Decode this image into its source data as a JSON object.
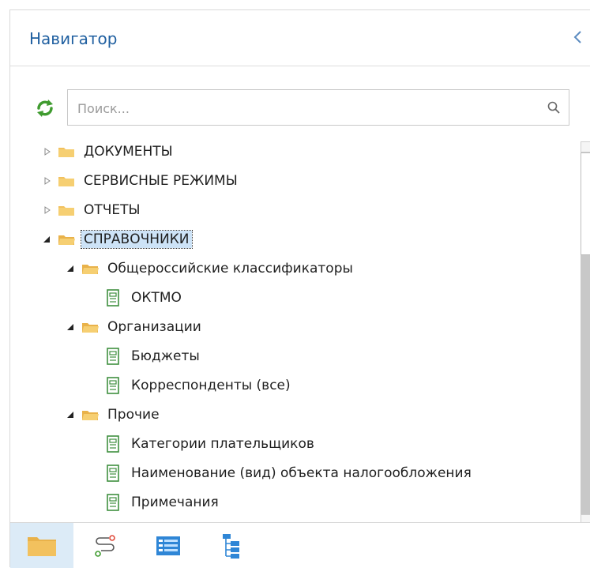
{
  "header": {
    "title": "Навигатор"
  },
  "search": {
    "placeholder": "Поиск..."
  },
  "tree": [
    {
      "label": "ДОКУМЕНТЫ",
      "type": "folder",
      "state": "collapsed"
    },
    {
      "label": "СЕРВИСНЫЕ РЕЖИМЫ",
      "type": "folder",
      "state": "collapsed"
    },
    {
      "label": "ОТЧЕТЫ",
      "type": "folder",
      "state": "collapsed"
    },
    {
      "label": "СПРАВОЧНИКИ",
      "type": "folder",
      "state": "expanded",
      "selected": true
    },
    {
      "label": "Общероссийские классификаторы",
      "type": "folder",
      "state": "expanded"
    },
    {
      "label": "ОКТМО",
      "type": "item"
    },
    {
      "label": "Организации",
      "type": "folder",
      "state": "expanded"
    },
    {
      "label": "Бюджеты",
      "type": "item"
    },
    {
      "label": "Корреспонденты (все)",
      "type": "item"
    },
    {
      "label": "Прочие",
      "type": "folder",
      "state": "expanded"
    },
    {
      "label": "Категории плательщиков",
      "type": "item"
    },
    {
      "label": "Наименование (вид) объекта налогообложения",
      "type": "item"
    },
    {
      "label": "Примечания",
      "type": "item"
    }
  ],
  "bottom_tabs": [
    {
      "name": "folders-tab",
      "icon": "folder-icon",
      "active": true
    },
    {
      "name": "routes-tab",
      "icon": "route-icon",
      "active": false
    },
    {
      "name": "list-tab",
      "icon": "list-icon",
      "active": false
    },
    {
      "name": "hierarchy-tab",
      "icon": "hierarchy-icon",
      "active": false
    }
  ],
  "colors": {
    "accent": "#1f5fa0",
    "folder": "#f2c15e",
    "refresh": "#3f9b2f",
    "active_tab": "#dcebf7"
  }
}
